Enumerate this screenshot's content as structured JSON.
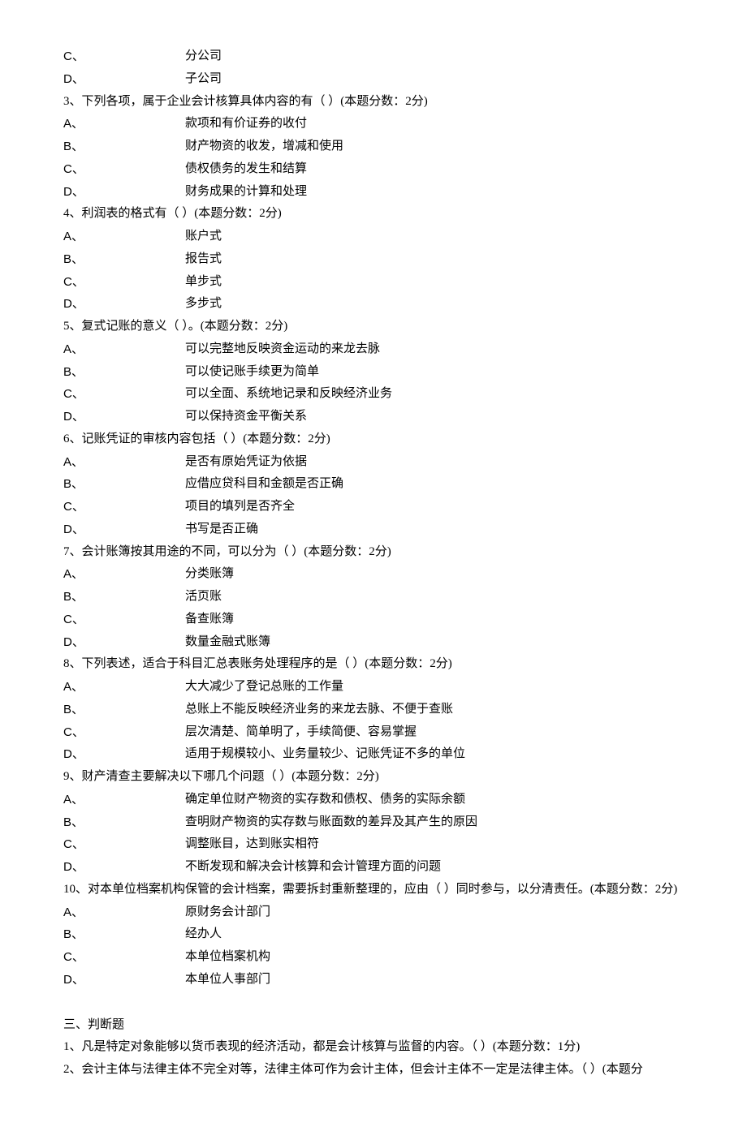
{
  "prior_options": [
    {
      "letter": "C、",
      "text": "分公司"
    },
    {
      "letter": "D、",
      "text": "子公司"
    }
  ],
  "questions": [
    {
      "stem": "3、下列各项，属于企业会计核算具体内容的有（  ）(本题分数：2分)",
      "options": [
        {
          "letter": "A、",
          "text": "款项和有价证券的收付"
        },
        {
          "letter": "B、",
          "text": "财产物资的收发，增减和使用"
        },
        {
          "letter": "C、",
          "text": "债权债务的发生和结算"
        },
        {
          "letter": "D、",
          "text": "财务成果的计算和处理"
        }
      ]
    },
    {
      "stem": "4、利润表的格式有（  ）(本题分数：2分)",
      "options": [
        {
          "letter": "A、",
          "text": "账户式"
        },
        {
          "letter": "B、",
          "text": "报告式"
        },
        {
          "letter": "C、",
          "text": "单步式"
        },
        {
          "letter": "D、",
          "text": "多步式"
        }
      ]
    },
    {
      "stem": "5、复式记账的意义（  ）。(本题分数：2分)",
      "options": [
        {
          "letter": "A、",
          "text": "可以完整地反映资金运动的来龙去脉"
        },
        {
          "letter": "B、",
          "text": "可以使记账手续更为简单"
        },
        {
          "letter": "C、",
          "text": "可以全面、系统地记录和反映经济业务"
        },
        {
          "letter": "D、",
          "text": "可以保持资金平衡关系"
        }
      ]
    },
    {
      "stem": "6、记账凭证的审核内容包括（  ）(本题分数：2分)",
      "options": [
        {
          "letter": "A、",
          "text": "是否有原始凭证为依据"
        },
        {
          "letter": "B、",
          "text": "应借应贷科目和金额是否正确"
        },
        {
          "letter": "C、",
          "text": "项目的填列是否齐全"
        },
        {
          "letter": "D、",
          "text": "书写是否正确"
        }
      ]
    },
    {
      "stem": "7、会计账簿按其用途的不同，可以分为（  ）(本题分数：2分)",
      "options": [
        {
          "letter": "A、",
          "text": "分类账簿"
        },
        {
          "letter": "B、",
          "text": "活页账"
        },
        {
          "letter": "C、",
          "text": "备查账簿"
        },
        {
          "letter": "D、",
          "text": "数量金融式账簿"
        }
      ]
    },
    {
      "stem": "8、下列表述，适合于科目汇总表账务处理程序的是（  ）(本题分数：2分)",
      "options": [
        {
          "letter": "A、",
          "text": "大大减少了登记总账的工作量"
        },
        {
          "letter": "B、",
          "text": "总账上不能反映经济业务的来龙去脉、不便于查账"
        },
        {
          "letter": "C、",
          "text": "层次清楚、简单明了，手续简便、容易掌握"
        },
        {
          "letter": "D、",
          "text": "适用于规模较小、业务量较少、记账凭证不多的单位"
        }
      ]
    },
    {
      "stem": "9、财产清查主要解决以下哪几个问题（  ）(本题分数：2分)",
      "options": [
        {
          "letter": "A、",
          "text": "确定单位财产物资的实存数和债权、债务的实际余额"
        },
        {
          "letter": "B、",
          "text": "查明财产物资的实存数与账面数的差异及其产生的原因"
        },
        {
          "letter": "C、",
          "text": "调整账目，达到账实相符"
        },
        {
          "letter": "D、",
          "text": "不断发现和解决会计核算和会计管理方面的问题"
        }
      ]
    },
    {
      "stem": "10、对本单位档案机构保管的会计档案，需要拆封重新整理的，应由（  ）同时参与，以分清责任。(本题分数：2分)",
      "options": [
        {
          "letter": "A、",
          "text": "原财务会计部门"
        },
        {
          "letter": "B、",
          "text": "经办人"
        },
        {
          "letter": "C、",
          "text": "本单位档案机构"
        },
        {
          "letter": "D、",
          "text": "本单位人事部门"
        }
      ]
    }
  ],
  "section3_title": "三、判断题",
  "tf_questions": [
    "1、凡是特定对象能够以货币表现的经济活动，都是会计核算与监督的内容。（  ）(本题分数：1分)",
    "2、会计主体与法律主体不完全对等，法律主体可作为会计主体，但会计主体不一定是法律主体。（  ）(本题分"
  ]
}
